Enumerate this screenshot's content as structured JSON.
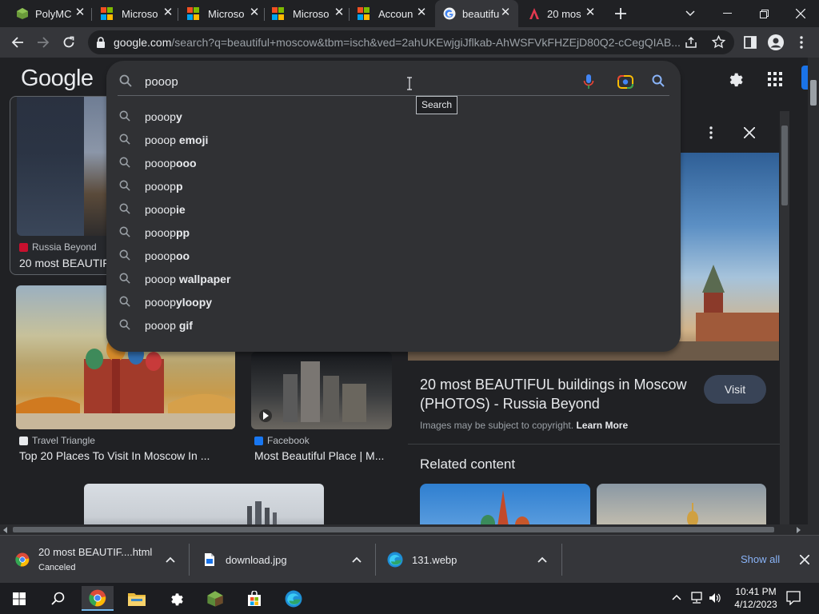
{
  "tabs": [
    {
      "label": "PolyMC",
      "icon": "polymc-icon",
      "active": false
    },
    {
      "label": "Microso",
      "icon": "microsoft-logo-icon",
      "active": false
    },
    {
      "label": "Microso",
      "icon": "microsoft-logo-icon",
      "active": false
    },
    {
      "label": "Microso",
      "icon": "microsoft-logo-icon",
      "active": false
    },
    {
      "label": "Accoun",
      "icon": "microsoft-logo-icon",
      "active": false
    },
    {
      "label": "beautifu",
      "icon": "google-icon",
      "active": true
    },
    {
      "label": "20 mos",
      "icon": "russia-beyond-icon",
      "active": false
    }
  ],
  "toolbar": {
    "url_host": "google.com",
    "url_rest": "/search?q=beautiful+moscow&tbm=isch&ved=2ahUKEwjgiJflkab-AhWSFVkFHZEjD80Q2-cCegQIAB..."
  },
  "google": {
    "logo": "Google",
    "query": "pooop",
    "tooltip": "Search",
    "suggestions": [
      {
        "typed": "pooop",
        "rest": "y"
      },
      {
        "typed": "pooop",
        "rest": " emoji"
      },
      {
        "typed": "pooop",
        "rest": "ooo"
      },
      {
        "typed": "pooop",
        "rest": "p"
      },
      {
        "typed": "pooop",
        "rest": "ie"
      },
      {
        "typed": "pooop",
        "rest": "pp"
      },
      {
        "typed": "pooop",
        "rest": "oo"
      },
      {
        "typed": "pooop",
        "rest": " wallpaper"
      },
      {
        "typed": "pooop",
        "rest": "yloopy"
      },
      {
        "typed": "pooop",
        "rest": " gif"
      }
    ]
  },
  "results": [
    {
      "source": "Russia Beyond",
      "title": "20 most BEAUTIF",
      "fav_color": "#c8102e"
    },
    {
      "source": "Travel Triangle",
      "title": "Top 20 Places To Visit In Moscow In ...",
      "fav_color": "#1a73e8"
    },
    {
      "source": "Facebook",
      "title": "Most Beautiful Place | M...",
      "fav_color": "#1877f2"
    }
  ],
  "side_panel": {
    "title": "20 most BEAUTIFUL buildings in Moscow (PHOTOS) - Russia Beyond",
    "visit": "Visit",
    "copyright": "Images may be subject to copyright.",
    "learn_more": "Learn More",
    "related": "Related content"
  },
  "downloads": [
    {
      "name": "20 most BEAUTIF....html",
      "status": "Canceled",
      "icon": "chrome-icon"
    },
    {
      "name": "download.jpg",
      "status": "",
      "icon": "file-icon"
    },
    {
      "name": "131.webp",
      "status": "",
      "icon": "edge-icon"
    }
  ],
  "download_bar": {
    "show_all": "Show all"
  },
  "taskbar": {
    "time": "10:41 PM",
    "date": "4/12/2023"
  },
  "colors": {
    "accent": "#8ab4f8",
    "active_tab": "#35363a",
    "page_bg": "#202124"
  }
}
